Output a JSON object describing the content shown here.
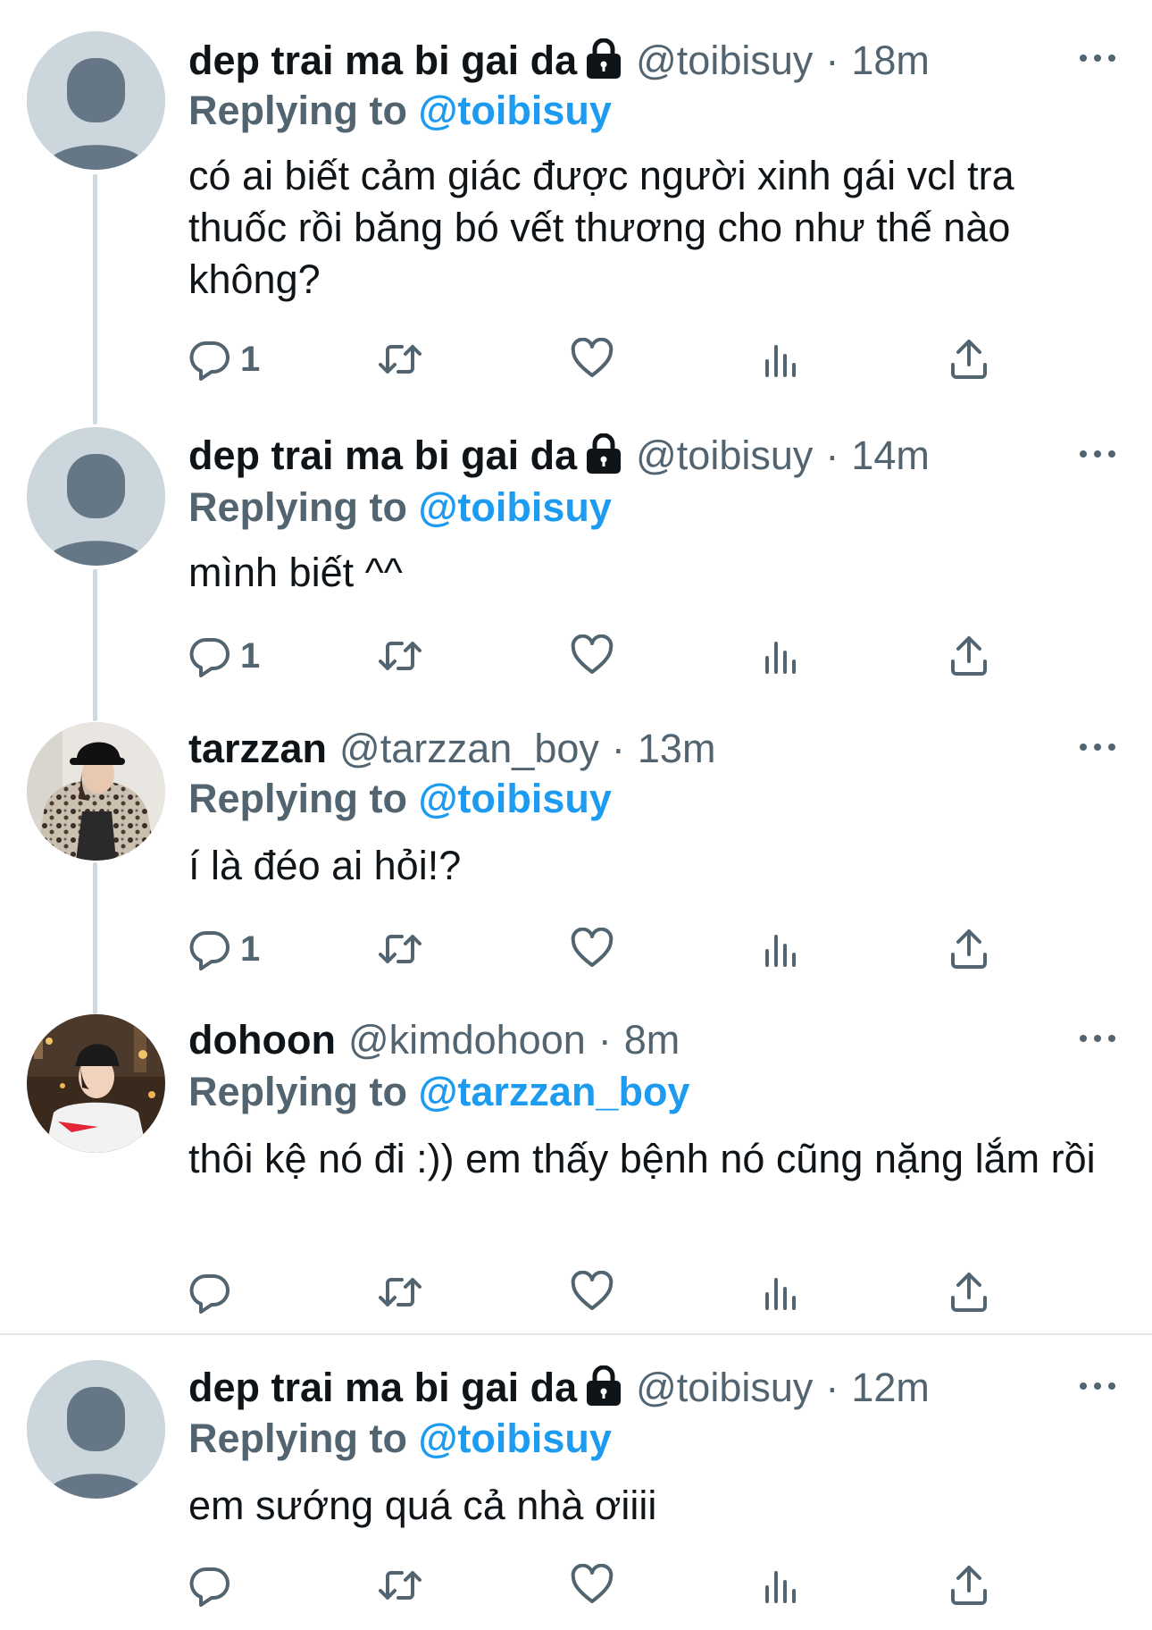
{
  "tweets": [
    {
      "name": "dep trai ma bi gai da",
      "locked": true,
      "handle": "@toibisuy",
      "separator": "·",
      "time": "18m",
      "replying_label": "Replying to",
      "replying_to": "@toibisuy",
      "text": "có ai biết cảm giác được người xinh gái vcl tra thuốc rồi băng bó vết thương cho như thế nào không?",
      "reply_count": "1",
      "avatar": "default-avatar"
    },
    {
      "name": "dep trai ma bi gai da",
      "locked": true,
      "handle": "@toibisuy",
      "separator": "·",
      "time": "14m",
      "replying_label": "Replying to",
      "replying_to": "@toibisuy",
      "text": "mình biết ^^",
      "reply_count": "1",
      "avatar": "default-avatar"
    },
    {
      "name": "tarzzan",
      "locked": false,
      "handle": "@tarzzan_boy",
      "separator": "·",
      "time": "13m",
      "replying_label": "Replying to",
      "replying_to": "@toibisuy",
      "text": "í là đéo ai hỏi!?",
      "reply_count": "1",
      "avatar": "photo-avatar-leopard-jacket"
    },
    {
      "name": "dohoon",
      "locked": false,
      "handle": "@kimdohoon",
      "separator": "·",
      "time": "8m",
      "replying_label": "Replying to",
      "replying_to": "@tarzzan_boy",
      "text": "thôi kệ nó đi :)) em thấy bệnh nó cũng nặng lắm rồi",
      "reply_count": "",
      "avatar": "photo-avatar-city-night"
    },
    {
      "name": "dep trai ma bi gai da",
      "locked": true,
      "handle": "@toibisuy",
      "separator": "·",
      "time": "12m",
      "replying_label": "Replying to",
      "replying_to": "@toibisuy",
      "text": "em sướng quá cả nhà ơiiii",
      "reply_count": "",
      "avatar": "default-avatar"
    }
  ],
  "icons": {
    "reply": "reply-icon",
    "retweet": "retweet-icon",
    "like": "heart-icon",
    "views": "views-icon",
    "share": "share-icon",
    "more": "more-icon",
    "lock": "lock-icon"
  },
  "colors": {
    "accent": "#1d9bf0",
    "secondary": "#536471",
    "text": "#0f1419",
    "thread_line": "#cfd9de"
  }
}
